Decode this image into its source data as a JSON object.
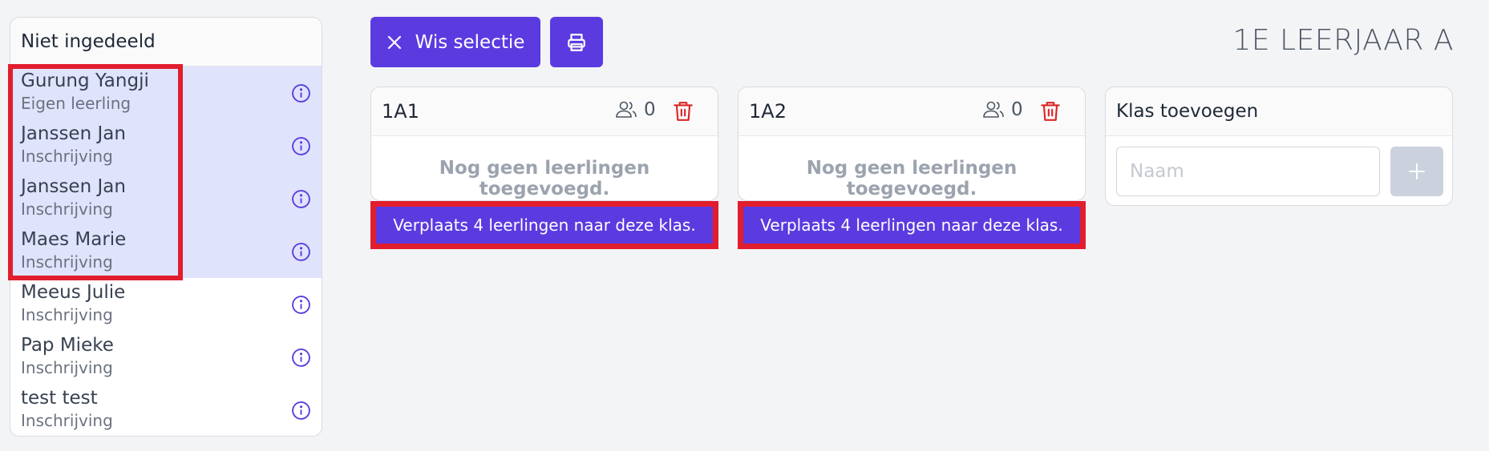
{
  "unassigned": {
    "title": "Niet ingedeeld",
    "students": [
      {
        "name": "Gurung Yangji",
        "type": "Eigen leerling",
        "selected": true
      },
      {
        "name": "Janssen Jan",
        "type": "Inschrijving",
        "selected": true
      },
      {
        "name": "Janssen Jan",
        "type": "Inschrijving",
        "selected": true
      },
      {
        "name": "Maes Marie",
        "type": "Inschrijving",
        "selected": true
      },
      {
        "name": "Meeus Julie",
        "type": "Inschrijving",
        "selected": false
      },
      {
        "name": "Pap Mieke",
        "type": "Inschrijving",
        "selected": false
      },
      {
        "name": "test test",
        "type": "Inschrijving",
        "selected": false
      }
    ]
  },
  "toolbar": {
    "clear_label": "Wis selectie",
    "clear_icon": "close-icon",
    "print_icon": "printer-icon"
  },
  "page_title": "1E LEERJAAR A",
  "classes": [
    {
      "name": "1A1",
      "count": "0",
      "empty_text": "Nog geen leerlingen toegevoegd.",
      "move_label": "Verplaats 4 leerlingen naar deze klas."
    },
    {
      "name": "1A2",
      "count": "0",
      "empty_text": "Nog geen leerlingen toegevoegd.",
      "move_label": "Verplaats 4 leerlingen naar deze klas."
    }
  ],
  "add_class": {
    "title": "Klas toevoegen",
    "placeholder": "Naam",
    "value": ""
  },
  "colors": {
    "accent": "#5b3be0",
    "selected_row": "#dfe3fb",
    "danger": "#dc2626",
    "highlight": "#e11d2e"
  }
}
